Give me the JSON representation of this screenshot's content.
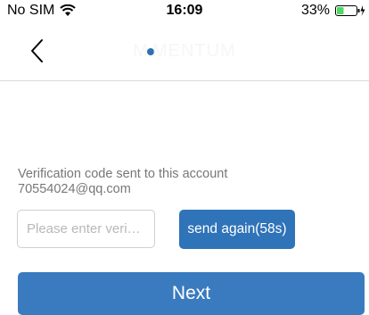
{
  "status_bar": {
    "carrier": "No SIM",
    "time": "16:09",
    "battery": "33%"
  },
  "nav": {
    "logo_text": "MOMENTUM",
    "logo_part1": "M",
    "logo_part2": "MENTUM"
  },
  "verification": {
    "line1": "Verification code sent to this account",
    "line2": "70554024@qq.com",
    "input_placeholder": "Please enter veri…",
    "send_again_label": "send again(58s)"
  },
  "next_label": "Next",
  "colors": {
    "primary": "#3a7bbf",
    "send_button": "#2f73b8",
    "battery_green": "#4cd964"
  },
  "icons": {
    "back": "chevron-left-icon",
    "wifi": "wifi-icon",
    "battery": "battery-icon",
    "charging": "charging-bolt-icon"
  }
}
